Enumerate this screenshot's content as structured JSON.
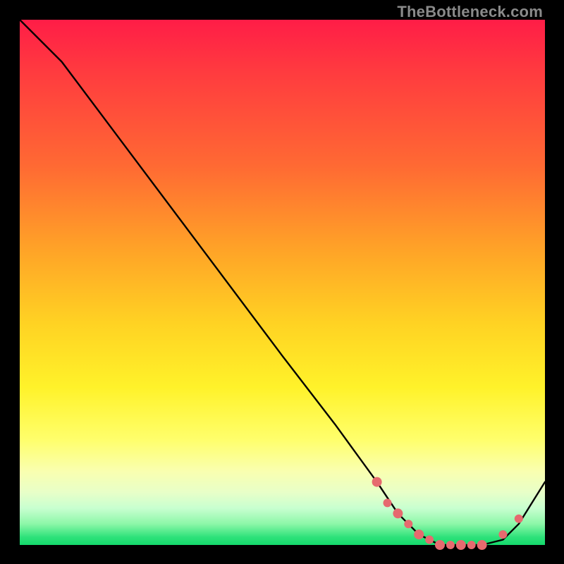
{
  "watermark": "TheBottleneck.com",
  "colors": {
    "frame": "#000000",
    "curve": "#000000",
    "dot": "#e66a6f",
    "gradient_top": "#ff1d47",
    "gradient_bottom": "#14d96c"
  },
  "chart_data": {
    "type": "line",
    "title": "",
    "xlabel": "",
    "ylabel": "",
    "xlim": [
      0,
      100
    ],
    "ylim": [
      0,
      100
    ],
    "x": [
      0,
      8,
      20,
      35,
      50,
      60,
      68,
      72,
      76,
      80,
      84,
      88,
      92,
      95,
      100
    ],
    "values": [
      100,
      92,
      76,
      56,
      36,
      23,
      12,
      6,
      2,
      0,
      0,
      0,
      1,
      4,
      12
    ],
    "dot_points": {
      "x": [
        68,
        70,
        72,
        74,
        76,
        78,
        80,
        82,
        84,
        86,
        88,
        92,
        95
      ],
      "y": [
        12,
        8,
        6,
        4,
        2,
        1,
        0,
        0,
        0,
        0,
        0,
        2,
        5
      ],
      "size": [
        7,
        6,
        7,
        6,
        7,
        6,
        7,
        6,
        7,
        6,
        7,
        6,
        6
      ]
    },
    "annotations": []
  }
}
